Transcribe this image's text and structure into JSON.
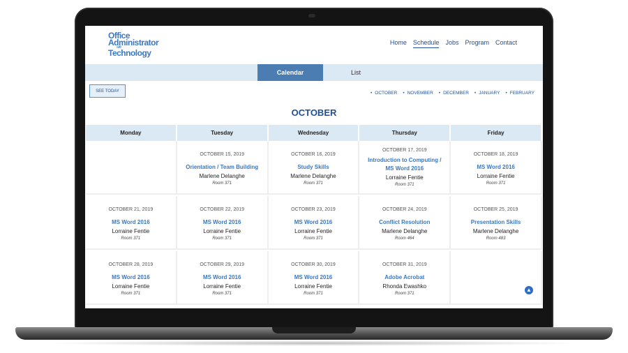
{
  "logo": {
    "line1": "Office",
    "line2": "Administrator",
    "line3": "with",
    "line4": "Technology"
  },
  "nav": [
    "Home",
    "Schedule",
    "Jobs",
    "Program",
    "Contact"
  ],
  "tabs": {
    "calendar": "Calendar",
    "list": "List"
  },
  "see_today": "SEE TODAY",
  "months": [
    "OCTOBER",
    "NOVEMBER",
    "DECEMBER",
    "JANUARY",
    "FEBRUARY"
  ],
  "month_title": "OCTOBER",
  "weekdays": [
    "Monday",
    "Tuesday",
    "Wednesday",
    "Thursday",
    "Friday"
  ],
  "weeks": [
    [
      null,
      {
        "date": "OCTOBER 15, 2019",
        "title": "Orientation / Team Building",
        "who": "Marlene Delanghe",
        "room": "Room 371"
      },
      {
        "date": "OCTOBER 16, 2019",
        "title": "Study Skills",
        "who": "Marlene Delanghe",
        "room": "Room 371"
      },
      {
        "date": "OCTOBER 17, 2019",
        "title": "Introduction to Computing / MS Word 2016",
        "who": "Lorraine Fentie",
        "room": "Room 371"
      },
      {
        "date": "OCTOBER 18, 2019",
        "title": "MS Word 2016",
        "who": "Lorraine Fentie",
        "room": "Room 371"
      }
    ],
    [
      {
        "date": "OCTOBER 21, 2019",
        "title": "MS Word 2016",
        "who": "Lorraine Fentie",
        "room": "Room 371"
      },
      {
        "date": "OCTOBER 22, 2019",
        "title": "MS Word 2016",
        "who": "Lorraine Fentie",
        "room": "Room 371"
      },
      {
        "date": "OCTOBER 23, 2019",
        "title": "MS Word 2016",
        "who": "Lorraine Fentie",
        "room": "Room 371"
      },
      {
        "date": "OCTOBER 24, 2019",
        "title": "Conflict Resolution",
        "who": "Marlene Delanghe",
        "room": "Room 464"
      },
      {
        "date": "OCTOBER 25, 2019",
        "title": "Presentation Skills",
        "who": "Marlene Delanghe",
        "room": "Room 483"
      }
    ],
    [
      {
        "date": "OCTOBER 28, 2019",
        "title": "MS Word 2016",
        "who": "Lorraine Fentie",
        "room": "Room 371"
      },
      {
        "date": "OCTOBER 29, 2019",
        "title": "MS Word 2016",
        "who": "Lorraine Fentie",
        "room": "Room 371"
      },
      {
        "date": "OCTOBER 30, 2019",
        "title": "MS Word 2016",
        "who": "Lorraine Fentie",
        "room": "Room 371"
      },
      {
        "date": "OCTOBER 31, 2019",
        "title": "Adobe Acrobat",
        "who": "Rhonda Ewashko",
        "room": "Room 371"
      },
      null
    ]
  ],
  "colors": {
    "accent": "#1f4f96",
    "tab_active": "#4c7db2",
    "link": "#3a78c0"
  },
  "icons": {
    "scroll_top": "chevron-up-icon"
  }
}
